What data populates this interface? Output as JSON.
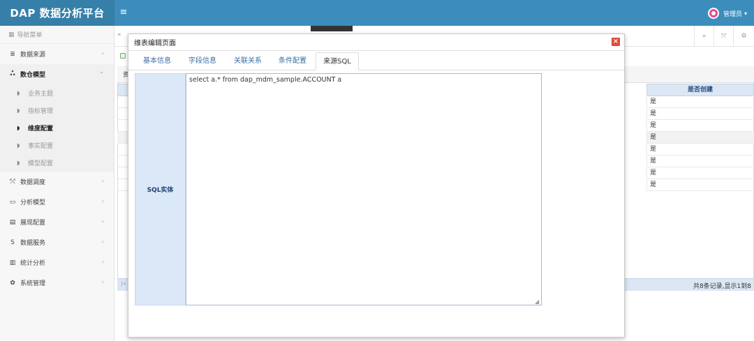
{
  "header": {
    "brand": "DAP 数据分析平台",
    "toggle_icon": "≡",
    "user_name": "管理员",
    "caret": "▾"
  },
  "sidebar": {
    "nav_title": "导航菜单",
    "items": [
      {
        "label": "数据来源",
        "icon": "≣"
      },
      {
        "label": "数仓模型",
        "icon": "ஃ"
      },
      {
        "label": "数据调度",
        "icon": "⤲"
      },
      {
        "label": "分析模型",
        "icon": "▭"
      },
      {
        "label": "展现配置",
        "icon": "▤"
      },
      {
        "label": "数据服务",
        "icon": "S"
      },
      {
        "label": "统计分析",
        "icon": "▥"
      },
      {
        "label": "系统管理",
        "icon": "✿"
      }
    ],
    "sub_items": [
      {
        "label": "业务主题"
      },
      {
        "label": "指标管理"
      },
      {
        "label": "维度配置"
      },
      {
        "label": "事实配置"
      },
      {
        "label": "模型配置"
      }
    ],
    "chevron": "‹",
    "chevron_open": "⌄"
  },
  "tabbar": {
    "left_btn": "«",
    "right_btns": [
      "»",
      "⤧",
      "⚙"
    ]
  },
  "background": {
    "label": "资",
    "col_header": "是否创建",
    "rows": [
      "是",
      "是",
      "是",
      "是",
      "是",
      "是",
      "是",
      "是"
    ],
    "pager_first": "|«",
    "pager_info": "共8条记录,显示1到8"
  },
  "dialog": {
    "title": "维表编辑页面",
    "close": "×",
    "tabs": [
      "基本信息",
      "字段信息",
      "关联关系",
      "条件配置",
      "来源SQL"
    ],
    "active_tab": 4,
    "field_label": "SQL实体",
    "sql": "select a.* from dap_mdm_sample.ACCOUNT a",
    "grip": "◢"
  },
  "colors": {
    "header": "#3c8dbc",
    "brand_bg": "#367fa9",
    "label_bg": "#dbe8f8",
    "close": "#e04a3a"
  }
}
